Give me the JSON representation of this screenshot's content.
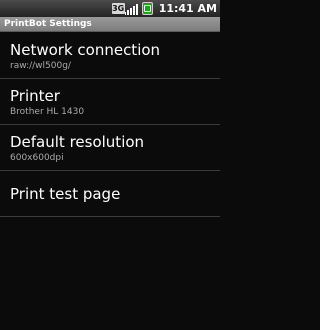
{
  "status_bar": {
    "network_type": "3G",
    "time": "11:41 AM",
    "icons": [
      "3g-icon",
      "signal-icon",
      "battery-icon"
    ],
    "battery_color": "#1fa31f"
  },
  "title_bar": {
    "title": "PrintBot Settings"
  },
  "preferences": [
    {
      "title": "Network connection",
      "summary": "raw://wl500g/"
    },
    {
      "title": "Printer",
      "summary": "Brother HL 1430"
    },
    {
      "title": "Default resolution",
      "summary": "600x600dpi"
    },
    {
      "title": "Print test page",
      "summary": ""
    }
  ]
}
